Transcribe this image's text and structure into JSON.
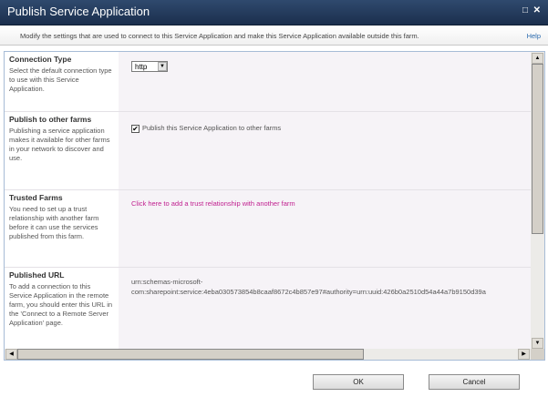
{
  "window": {
    "title": "Publish Service Application",
    "maximize_icon": "maximize-icon",
    "close_icon": "close-icon"
  },
  "description": {
    "text": "Modify the settings that are used to connect to this Service Application and make this Service Application available outside this farm.",
    "help": "Help"
  },
  "sections": [
    {
      "title": "Connection Type",
      "desc": "Select the default connection type to use with this Service Application.",
      "select_value": "http"
    },
    {
      "title": "Publish to other farms",
      "desc": "Publishing a service application makes it available for other farms in your network to discover and use.",
      "checkbox_label": "Publish this Service Application to other farms",
      "checked": true
    },
    {
      "title": "Trusted Farms",
      "desc": "You need to set up a trust relationship with another farm before it can use the services published from this farm.",
      "link": "Click here to add a trust relationship with another farm"
    },
    {
      "title": "Published URL",
      "desc": "To add a connection to this Service Application in the remote farm, you should enter this URL in the 'Connect to a Remote Server Application' page.",
      "url_line1": "urn:schemas-microsoft-",
      "url_line2": "com:sharepoint:service:4eba030573854b8caaf8672c4b857e97#authority=urn:uuid:426b0a2510d54a44a7b9150d39a"
    }
  ],
  "buttons": {
    "ok": "OK",
    "cancel": "Cancel"
  },
  "colors": {
    "titlebar": "#1b2f4d",
    "link": "#c01f8f",
    "help": "#2a6aae"
  }
}
